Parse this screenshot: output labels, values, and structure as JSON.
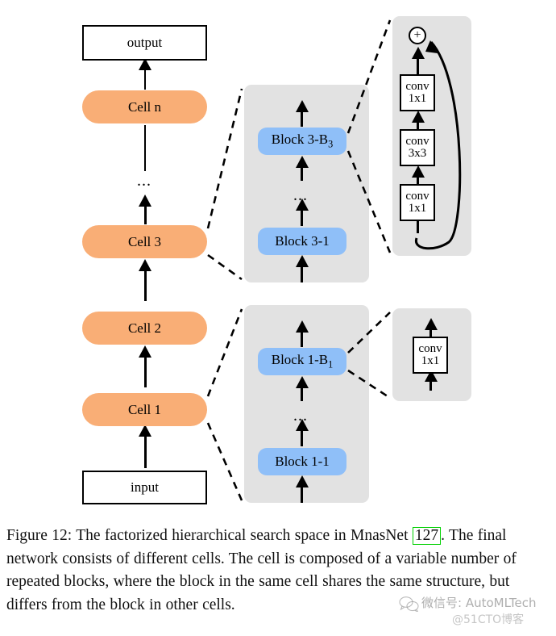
{
  "figure": {
    "left_column": {
      "output_label": "output",
      "cells": [
        "Cell n",
        "Cell 3",
        "Cell 2",
        "Cell 1"
      ],
      "input_label": "input",
      "ellipsis": "..."
    },
    "cell3_panel": {
      "top_block": "Block 3-B",
      "top_block_subscript": "3",
      "bottom_block": "Block 3-1",
      "ellipsis": "..."
    },
    "cell1_panel": {
      "top_block": "Block 1-B",
      "top_block_subscript": "1",
      "bottom_block": "Block 1-1",
      "ellipsis": "..."
    },
    "block3_detail": {
      "add_symbol": "+",
      "layers": [
        {
          "line1": "conv",
          "line2": "1x1"
        },
        {
          "line1": "conv",
          "line2": "3x3"
        },
        {
          "line1": "conv",
          "line2": "1x1"
        }
      ]
    },
    "block1_detail": {
      "layers": [
        {
          "line1": "conv",
          "line2": "1x1"
        }
      ]
    },
    "colors": {
      "cell_fill": "#F9AE76",
      "block_fill": "#8FBFF8",
      "panel_fill": "#E2E2E2",
      "stroke": "#000000",
      "citation_box": "#00D000"
    }
  },
  "caption": {
    "part1": "Figure 12: The factorized hierarchical search space in MnasNet ",
    "citation": "127",
    "part2": ". The final network consists of different cells. The cell is composed of a variable number of repeated blocks, where the block in the same cell shares the same structure, but differs from the block in other cells."
  },
  "watermark": {
    "line1": "微信号: AutoMLTech",
    "line2": "@51CTO博客"
  }
}
